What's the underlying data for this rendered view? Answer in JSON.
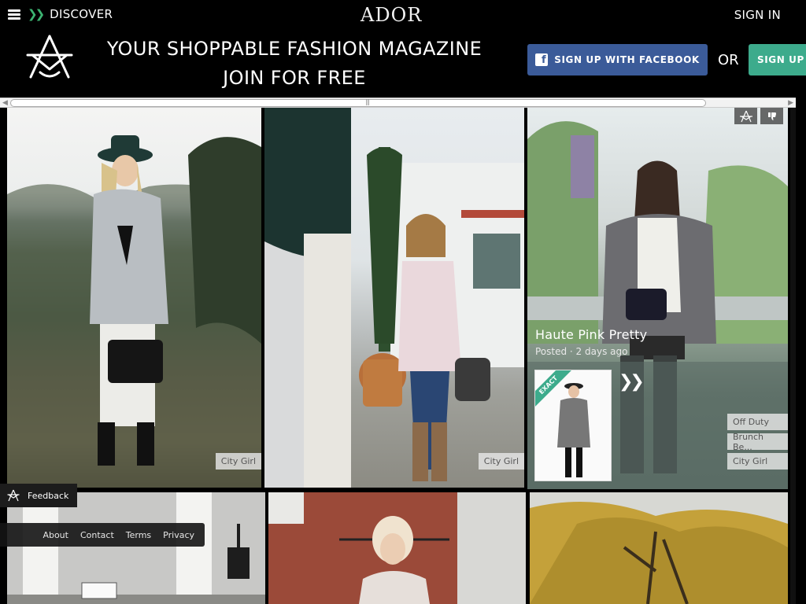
{
  "header": {
    "discover_label": "DISCOVER",
    "brand": "ADOR",
    "sign_in": "SIGN IN",
    "tagline_line1": "YOUR SHOPPABLE FASHION MAGAZINE",
    "tagline_line2": "JOIN FOR FREE",
    "facebook_button": "SIGN UP WITH FACEBOOK",
    "or_label": "OR",
    "signup_button": "SIGN UP",
    "facebook_color": "#3b5b99",
    "signup_color": "#3dab8c"
  },
  "scrollbar": {
    "grip": "|||"
  },
  "tiles": [
    {
      "tag": "City Girl"
    },
    {
      "tag": "City Girl"
    },
    {
      "title": "Haute Pink Pretty",
      "meta": "Posted · 2 days ago",
      "badge": "EXACT",
      "tags": [
        "Off Duty",
        "Brunch Be...",
        "City Girl"
      ]
    }
  ],
  "feedback": {
    "label": "Feedback"
  },
  "footer": {
    "links": [
      "About",
      "Contact",
      "Terms",
      "Privacy"
    ]
  }
}
